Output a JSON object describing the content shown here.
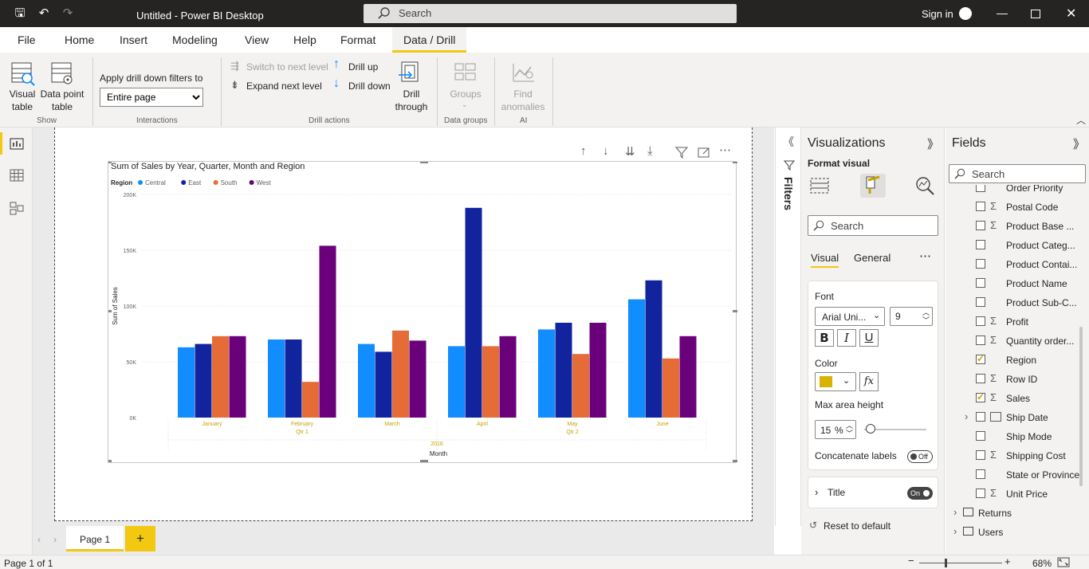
{
  "titlebar": {
    "title": "Untitled - Power BI Desktop",
    "search_placeholder": "Search",
    "signin": "Sign in"
  },
  "menu": {
    "items": [
      "File",
      "Home",
      "Insert",
      "Modeling",
      "View",
      "Help",
      "Format",
      "Data / Drill"
    ],
    "active": "Data / Drill"
  },
  "ribbon": {
    "visual_table": "Visual\ntable",
    "data_point_table": "Data point\ntable",
    "show_group": "Show",
    "apply_label": "Apply drill down filters to",
    "apply_value": "Entire page",
    "interactions_group": "Interactions",
    "switch_next": "Switch to next level",
    "expand_next": "Expand next level",
    "drill_up": "Drill up",
    "drill_down": "Drill down",
    "drill_through": "Drill\nthrough",
    "drill_actions_group": "Drill actions",
    "groups": "Groups",
    "data_groups_group": "Data groups",
    "find_anomalies": "Find\nanomalies",
    "ai_group": "AI"
  },
  "chart_data": {
    "type": "bar",
    "title": "Sum of Sales by Year, Quarter, Month and Region",
    "legend_title": "Region",
    "legend_position": "top-left",
    "xlabel": "Month",
    "ylabel": "Sum of Sales",
    "ylim": [
      0,
      200000
    ],
    "yticks": [
      "0K",
      "50K",
      "100K",
      "150K",
      "200K"
    ],
    "categories": [
      "January",
      "February",
      "March",
      "April",
      "May",
      "June"
    ],
    "quarter_labels": [
      {
        "label": "Qtr 1",
        "under": "February"
      },
      {
        "label": "Qtr 2",
        "under": "May"
      }
    ],
    "year_label": "2016",
    "grid": true,
    "series": [
      {
        "name": "Central",
        "color": "#118dff",
        "values": [
          63000,
          70000,
          66000,
          64000,
          79000,
          106000
        ]
      },
      {
        "name": "East",
        "color": "#12239e",
        "values": [
          66000,
          70000,
          59000,
          188000,
          85000,
          123000
        ]
      },
      {
        "name": "South",
        "color": "#e66c37",
        "values": [
          73000,
          32000,
          78000,
          64000,
          57000,
          53000
        ]
      },
      {
        "name": "West",
        "color": "#6b007b",
        "values": [
          73000,
          154000,
          69000,
          73000,
          85000,
          73000
        ]
      }
    ]
  },
  "filters": {
    "label": "Filters"
  },
  "viz": {
    "title": "Visualizations",
    "format_visual": "Format visual",
    "search": "Search",
    "tab_visual": "Visual",
    "tab_general": "General",
    "font_label": "Font",
    "font_value": "Arial Uni...",
    "font_size": "9",
    "bold": "B",
    "italic": "I",
    "underline": "U",
    "color_label": "Color",
    "color_value": "#d9b300",
    "fx": "fx",
    "max_area_label": "Max area height",
    "max_area_value": "15",
    "max_area_unit": "%",
    "max_area_fraction": 0.15,
    "concat_label": "Concatenate labels",
    "concat_state": "Off",
    "title_card": "Title",
    "title_state": "On",
    "reset": "Reset to default"
  },
  "fields": {
    "title": "Fields",
    "search": "Search",
    "items": [
      {
        "name": "Order Priority",
        "sigma": false,
        "checked": false
      },
      {
        "name": "Postal Code",
        "sigma": true,
        "checked": false
      },
      {
        "name": "Product Base ...",
        "sigma": true,
        "checked": false
      },
      {
        "name": "Product Categ...",
        "sigma": false,
        "checked": false
      },
      {
        "name": "Product Contai...",
        "sigma": false,
        "checked": false
      },
      {
        "name": "Product Name",
        "sigma": false,
        "checked": false
      },
      {
        "name": "Product Sub-C...",
        "sigma": false,
        "checked": false
      },
      {
        "name": "Profit",
        "sigma": true,
        "checked": false
      },
      {
        "name": "Quantity order...",
        "sigma": true,
        "checked": false
      },
      {
        "name": "Region",
        "sigma": false,
        "checked": true
      },
      {
        "name": "Row ID",
        "sigma": true,
        "checked": false
      },
      {
        "name": "Sales",
        "sigma": true,
        "checked": true
      },
      {
        "name": "Ship Date",
        "sigma": false,
        "checked": false,
        "table_icon": true
      },
      {
        "name": "Ship Mode",
        "sigma": false,
        "checked": false
      },
      {
        "name": "Shipping Cost",
        "sigma": true,
        "checked": false
      },
      {
        "name": "State or Province",
        "sigma": false,
        "checked": false
      },
      {
        "name": "Unit Price",
        "sigma": true,
        "checked": false
      }
    ],
    "tables": [
      "Returns",
      "Users"
    ]
  },
  "tabs": {
    "page1": "Page 1",
    "add": "+"
  },
  "status": {
    "page": "Page 1 of 1",
    "zoom": "68%",
    "minus": "−",
    "plus": "+"
  }
}
